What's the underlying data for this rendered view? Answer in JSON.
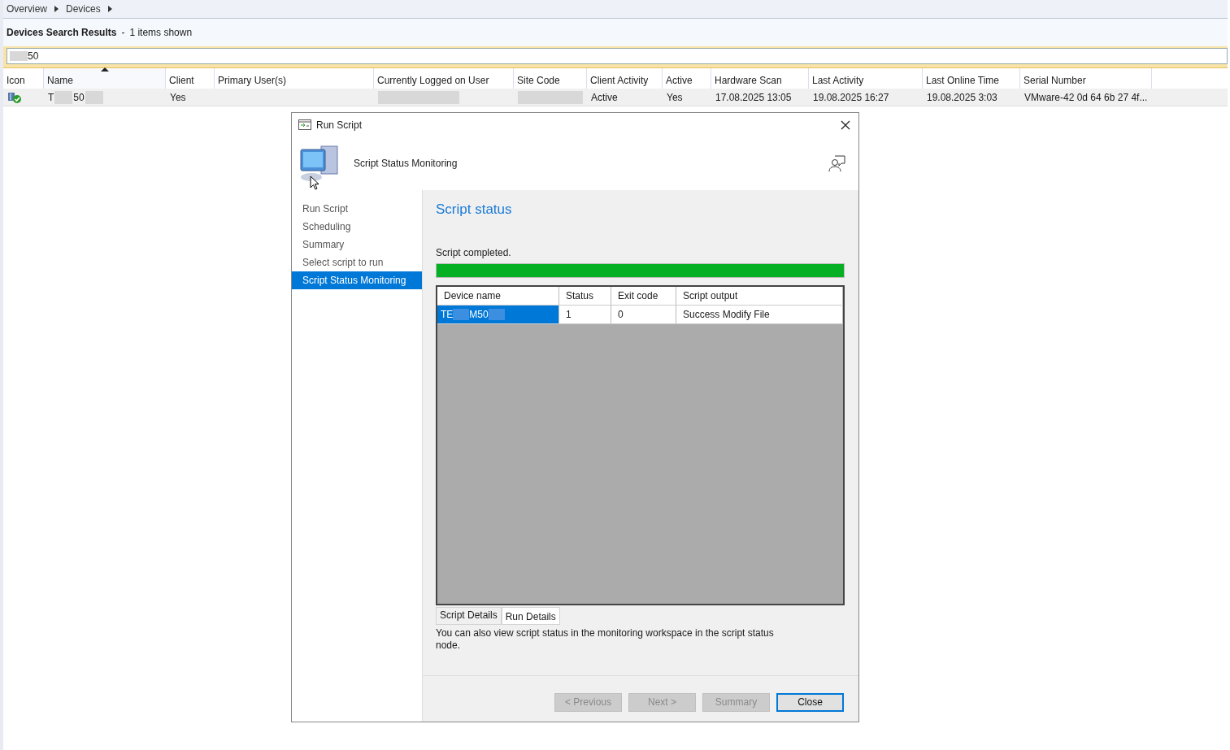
{
  "breadcrumb": [
    {
      "label": "Overview"
    },
    {
      "label": "Devices"
    }
  ],
  "results": {
    "title": "Devices Search Results",
    "separator": "-",
    "count": "1 items shown"
  },
  "search": {
    "parts": [
      {
        "kind": "mask"
      },
      {
        "kind": "text",
        "text": "50"
      }
    ]
  },
  "table": {
    "columns": [
      {
        "label": "Icon",
        "sorted": false
      },
      {
        "label": "Name",
        "sorted": true
      },
      {
        "label": "Client",
        "sorted": false
      },
      {
        "label": "Primary User(s)",
        "sorted": false
      },
      {
        "label": "Currently Logged on User",
        "sorted": false
      },
      {
        "label": "Site Code",
        "sorted": false
      },
      {
        "label": "Client Activity",
        "sorted": false
      },
      {
        "label": "Active",
        "sorted": false
      },
      {
        "label": "Hardware Scan",
        "sorted": false
      },
      {
        "label": "Last Activity",
        "sorted": false
      },
      {
        "label": "Last Online Time",
        "sorted": false
      },
      {
        "label": "Serial Number",
        "sorted": false
      }
    ],
    "rows": [
      {
        "cells": [
          {
            "kind": "icon"
          },
          {
            "kind": "masked",
            "parts": [
              {
                "kind": "text",
                "text": "T"
              },
              {
                "kind": "mask"
              },
              {
                "kind": "text",
                "text": "50"
              },
              {
                "kind": "mask"
              }
            ]
          },
          {
            "kind": "text",
            "text": "Yes"
          },
          {
            "kind": "empty"
          },
          {
            "kind": "masked",
            "parts": [
              {
                "kind": "mask"
              }
            ]
          },
          {
            "kind": "masked",
            "parts": [
              {
                "kind": "mask"
              }
            ]
          },
          {
            "kind": "text",
            "text": "Active"
          },
          {
            "kind": "text",
            "text": "Yes"
          },
          {
            "kind": "text",
            "text": "17.08.2025 13:05"
          },
          {
            "kind": "text",
            "text": "19.08.2025 16:27"
          },
          {
            "kind": "text",
            "text": "19.08.2025 3:03"
          },
          {
            "kind": "text",
            "text": "VMware-42 0d 64 6b 27 4f..."
          }
        ]
      }
    ]
  },
  "dialog": {
    "title": "Run Script",
    "header": "Script Status Monitoring",
    "nav": [
      {
        "label": "Run Script",
        "selected": false
      },
      {
        "label": "Scheduling",
        "selected": false
      },
      {
        "label": "Summary",
        "selected": false
      },
      {
        "label": "Select script to run",
        "selected": false
      },
      {
        "label": "Script Status Monitoring",
        "selected": true
      }
    ],
    "heading": "Script status",
    "message": "Script completed.",
    "progress": {
      "level": 1
    },
    "grid": {
      "columns": [
        "Device name",
        "Status",
        "Exit code",
        "Script output"
      ],
      "rows": [
        {
          "selected": true,
          "cells": [
            {
              "kind": "masked",
              "parts": [
                {
                  "kind": "text",
                  "text": "TE"
                },
                {
                  "kind": "mask"
                },
                {
                  "kind": "text",
                  "text": "M50"
                },
                {
                  "kind": "mask"
                }
              ]
            },
            {
              "kind": "text",
              "text": "1"
            },
            {
              "kind": "text",
              "text": "0"
            },
            {
              "kind": "text",
              "text": "Success Modify File"
            }
          ]
        }
      ]
    },
    "tabs": [
      {
        "label": "Script Details",
        "selected": false
      },
      {
        "label": "Run Details",
        "selected": true
      }
    ],
    "note": "You can also view script status in the monitoring workspace in the script status node.",
    "buttons": [
      {
        "label": "< Previous",
        "disabled": true,
        "default": false
      },
      {
        "label": "Next >",
        "disabled": true,
        "default": false
      },
      {
        "label": "Summary",
        "disabled": true,
        "default": false
      },
      {
        "label": "Close",
        "disabled": false,
        "default": true
      }
    ]
  }
}
